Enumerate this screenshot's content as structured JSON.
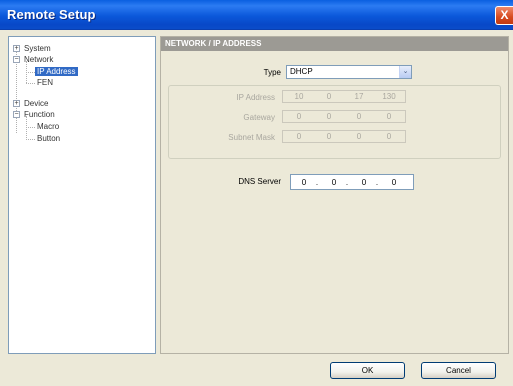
{
  "window": {
    "title": "Remote Setup",
    "close_glyph": "X"
  },
  "tree": {
    "items": [
      {
        "label": "System",
        "expander": "+"
      },
      {
        "label": "Network",
        "expander": "−"
      },
      {
        "label": "IP Address"
      },
      {
        "label": "FEN"
      },
      {
        "label": "Device",
        "expander": "+"
      },
      {
        "label": "Function",
        "expander": "−"
      },
      {
        "label": "Macro"
      },
      {
        "label": "Button"
      }
    ],
    "selected": "IP Address"
  },
  "content": {
    "header": "NETWORK / IP ADDRESS",
    "type": {
      "label": "Type",
      "value": "DHCP",
      "arrow": "⌄"
    },
    "ip_address": {
      "label": "IP Address",
      "octets": [
        "10",
        "0",
        "17",
        "130"
      ]
    },
    "gateway": {
      "label": "Gateway",
      "octets": [
        "0",
        "0",
        "0",
        "0"
      ]
    },
    "subnet_mask": {
      "label": "Subnet Mask",
      "octets": [
        "0",
        "0",
        "0",
        "0"
      ]
    },
    "dns_server": {
      "label": "DNS Server",
      "octets": [
        "0",
        "0",
        "0",
        "0"
      ]
    }
  },
  "buttons": {
    "ok": "OK",
    "cancel": "Cancel"
  }
}
